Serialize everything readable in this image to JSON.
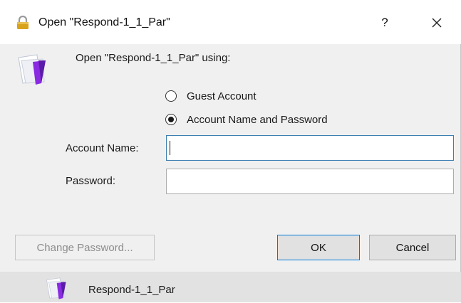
{
  "window": {
    "title": "Open \"Respond-1_1_Par\"",
    "help_label": "?",
    "lock_icon": "lock-icon",
    "close_icon": "close-icon"
  },
  "main": {
    "app_icon": "filemaker-folder-icon",
    "prompt": "Open \"Respond-1_1_Par\" using:",
    "options": [
      {
        "label": "Guest Account",
        "checked": false
      },
      {
        "label": "Account Name and Password",
        "checked": true
      }
    ],
    "account_name": {
      "label": "Account Name:",
      "value": "",
      "placeholder": ""
    },
    "password": {
      "label": "Password:",
      "value": "",
      "placeholder": ""
    }
  },
  "buttons": {
    "change_password": "Change Password...",
    "ok": "OK",
    "cancel": "Cancel"
  },
  "taskbar": {
    "item_label": "Respond-1_1_Par",
    "item_icon": "filemaker-folder-icon"
  },
  "colors": {
    "dialog_bg": "#f0f0f0",
    "titlebar_bg": "#ffffff",
    "focus_border": "#3c7fb1",
    "default_button_border": "#0078d7",
    "icon_purple": "#8a2be2",
    "lock_gold": "#d9a21b"
  }
}
